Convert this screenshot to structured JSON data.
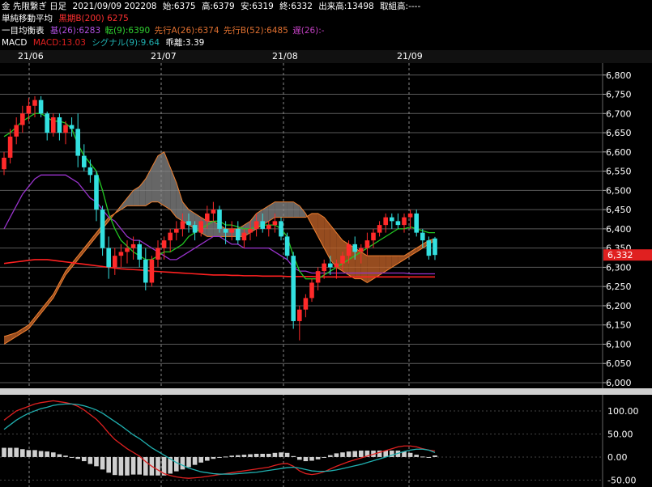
{
  "header": {
    "line1": {
      "instrument": "金 先限繋ぎ 日足",
      "date": "2021/09/09 202208",
      "open": "始:6375",
      "high": "高:6379",
      "low": "安:6319",
      "close": "終:6332",
      "volume": "出来高:13498",
      "oi": "取組高:----"
    },
    "line2": {
      "label": "単純移動平均",
      "ma200": "黒期B(200) 6275"
    },
    "line3": {
      "label": "一目均衡表",
      "kijun": "基(26):6283",
      "tenkan": "転(9):6390",
      "senkouA": "先行A(26):6374",
      "senkouB": "先行B(52):6485",
      "chikou": "遅(26):-"
    },
    "line4": {
      "label": "MACD",
      "macd": "MACD:13.03",
      "signal": "シグナル(9):9.64",
      "diff": "乖離:3.39"
    }
  },
  "time_axis": [
    "21/06",
    "21/07",
    "21/08",
    "21/09"
  ],
  "price_axis": [
    "6,800",
    "6,750",
    "6,700",
    "6,650",
    "6,600",
    "6,550",
    "6,500",
    "6,450",
    "6,400",
    "6,350",
    "6,300",
    "6,250",
    "6,200",
    "6,150",
    "6,100",
    "6,050",
    "6,000"
  ],
  "current_price_label": "6,332",
  "macd_axis": [
    "100.00",
    "50.00",
    "0.00",
    "-50.00"
  ],
  "colors": {
    "up": "#ff2a2a",
    "down": "#33e0e0",
    "tenkan": "#22c822",
    "kijun": "#9933cc",
    "cloud_bull": "#c8662a",
    "cloud_bear": "#888888",
    "ma200": "#ff2020",
    "macd": "#e02020",
    "signal": "#20b0b0",
    "hist": "#cfcfcf",
    "price_box": "#e02020"
  },
  "chart_data": {
    "type": "candlestick",
    "y_range": [
      6000,
      6810
    ],
    "macd_range": [
      -65,
      135
    ],
    "dates": [
      "06/01",
      "06/02",
      "06/03",
      "06/04",
      "06/07",
      "06/08",
      "06/09",
      "06/10",
      "06/11",
      "06/14",
      "06/15",
      "06/16",
      "06/17",
      "06/18",
      "06/21",
      "06/22",
      "06/23",
      "06/24",
      "06/25",
      "06/28",
      "06/29",
      "06/30",
      "07/01",
      "07/02",
      "07/05",
      "07/06",
      "07/07",
      "07/08",
      "07/09",
      "07/12",
      "07/13",
      "07/14",
      "07/15",
      "07/16",
      "07/19",
      "07/20",
      "07/21",
      "07/22",
      "07/26",
      "07/27",
      "07/28",
      "07/29",
      "07/30",
      "08/02",
      "08/03",
      "08/04",
      "08/05",
      "08/06",
      "08/10",
      "08/11",
      "08/12",
      "08/13",
      "08/16",
      "08/17",
      "08/18",
      "08/19",
      "08/20",
      "08/23",
      "08/24",
      "08/25",
      "08/26",
      "08/27",
      "08/30",
      "08/31",
      "09/01",
      "09/02",
      "09/03",
      "09/06",
      "09/07",
      "09/08",
      "09/09"
    ],
    "ohlc": [
      [
        6555,
        6600,
        6540,
        6585
      ],
      [
        6585,
        6660,
        6570,
        6640
      ],
      [
        6640,
        6690,
        6620,
        6670
      ],
      [
        6670,
        6720,
        6650,
        6700
      ],
      [
        6700,
        6740,
        6680,
        6720
      ],
      [
        6720,
        6745,
        6690,
        6735
      ],
      [
        6735,
        6745,
        6690,
        6700
      ],
      [
        6700,
        6705,
        6630,
        6650
      ],
      [
        6650,
        6700,
        6640,
        6690
      ],
      [
        6690,
        6700,
        6630,
        6650
      ],
      [
        6650,
        6680,
        6620,
        6670
      ],
      [
        6670,
        6690,
        6640,
        6660
      ],
      [
        6660,
        6700,
        6560,
        6590
      ],
      [
        6590,
        6620,
        6550,
        6560
      ],
      [
        6560,
        6580,
        6520,
        6540
      ],
      [
        6540,
        6550,
        6420,
        6450
      ],
      [
        6450,
        6460,
        6330,
        6350
      ],
      [
        6350,
        6380,
        6270,
        6300
      ],
      [
        6300,
        6350,
        6280,
        6330
      ],
      [
        6330,
        6360,
        6300,
        6340
      ],
      [
        6340,
        6370,
        6310,
        6350
      ],
      [
        6350,
        6380,
        6320,
        6360
      ],
      [
        6360,
        6370,
        6300,
        6320
      ],
      [
        6320,
        6350,
        6240,
        6260
      ],
      [
        6260,
        6330,
        6250,
        6320
      ],
      [
        6320,
        6370,
        6300,
        6350
      ],
      [
        6350,
        6380,
        6320,
        6370
      ],
      [
        6370,
        6400,
        6340,
        6390
      ],
      [
        6390,
        6420,
        6370,
        6400
      ],
      [
        6400,
        6440,
        6380,
        6420
      ],
      [
        6420,
        6440,
        6390,
        6410
      ],
      [
        6410,
        6420,
        6370,
        6390
      ],
      [
        6390,
        6430,
        6380,
        6420
      ],
      [
        6420,
        6460,
        6400,
        6440
      ],
      [
        6440,
        6470,
        6420,
        6450
      ],
      [
        6450,
        6460,
        6390,
        6400
      ],
      [
        6400,
        6420,
        6360,
        6390
      ],
      [
        6390,
        6420,
        6370,
        6400
      ],
      [
        6400,
        6420,
        6360,
        6370
      ],
      [
        6370,
        6400,
        6350,
        6390
      ],
      [
        6390,
        6420,
        6370,
        6400
      ],
      [
        6400,
        6440,
        6380,
        6420
      ],
      [
        6420,
        6440,
        6390,
        6400
      ],
      [
        6400,
        6420,
        6380,
        6410
      ],
      [
        6410,
        6440,
        6390,
        6420
      ],
      [
        6420,
        6430,
        6370,
        6380
      ],
      [
        6380,
        6390,
        6320,
        6330
      ],
      [
        6330,
        6340,
        6140,
        6160
      ],
      [
        6160,
        6200,
        6110,
        6190
      ],
      [
        6190,
        6230,
        6170,
        6220
      ],
      [
        6220,
        6270,
        6210,
        6260
      ],
      [
        6260,
        6300,
        6240,
        6290
      ],
      [
        6290,
        6320,
        6270,
        6310
      ],
      [
        6310,
        6330,
        6280,
        6300
      ],
      [
        6300,
        6320,
        6270,
        6310
      ],
      [
        6310,
        6340,
        6290,
        6330
      ],
      [
        6330,
        6370,
        6310,
        6360
      ],
      [
        6360,
        6380,
        6320,
        6340
      ],
      [
        6340,
        6360,
        6310,
        6350
      ],
      [
        6350,
        6390,
        6330,
        6370
      ],
      [
        6370,
        6400,
        6350,
        6390
      ],
      [
        6390,
        6420,
        6380,
        6410
      ],
      [
        6410,
        6440,
        6390,
        6430
      ],
      [
        6430,
        6440,
        6400,
        6420
      ],
      [
        6420,
        6440,
        6400,
        6410
      ],
      [
        6410,
        6440,
        6390,
        6430
      ],
      [
        6430,
        6450,
        6400,
        6440
      ],
      [
        6440,
        6450,
        6380,
        6390
      ],
      [
        6390,
        6400,
        6350,
        6370
      ],
      [
        6370,
        6380,
        6320,
        6330
      ],
      [
        6375,
        6379,
        6319,
        6332
      ]
    ],
    "tenkan": [
      6640,
      6650,
      6665,
      6680,
      6690,
      6700,
      6700,
      6690,
      6680,
      6680,
      6675,
      6660,
      6620,
      6590,
      6570,
      6550,
      6500,
      6440,
      6400,
      6370,
      6355,
      6340,
      6330,
      6320,
      6320,
      6330,
      6340,
      6340,
      6350,
      6360,
      6380,
      6390,
      6400,
      6410,
      6420,
      6420,
      6410,
      6410,
      6405,
      6400,
      6400,
      6405,
      6410,
      6410,
      6410,
      6400,
      6380,
      6330,
      6290,
      6270,
      6270,
      6270,
      6280,
      6290,
      6300,
      6310,
      6320,
      6330,
      6340,
      6350,
      6360,
      6370,
      6380,
      6390,
      6400,
      6400,
      6405,
      6400,
      6395,
      6390,
      6390
    ],
    "kijun": [
      6400,
      6430,
      6460,
      6490,
      6510,
      6530,
      6540,
      6540,
      6540,
      6540,
      6540,
      6530,
      6520,
      6500,
      6480,
      6470,
      6450,
      6430,
      6420,
      6400,
      6380,
      6370,
      6370,
      6360,
      6350,
      6340,
      6330,
      6320,
      6320,
      6330,
      6340,
      6350,
      6360,
      6370,
      6380,
      6380,
      6370,
      6360,
      6360,
      6350,
      6350,
      6350,
      6350,
      6350,
      6340,
      6330,
      6320,
      6300,
      6290,
      6290,
      6285,
      6285,
      6285,
      6285,
      6285,
      6285,
      6285,
      6285,
      6285,
      6285,
      6285,
      6285,
      6285,
      6285,
      6285,
      6285,
      6283,
      6283,
      6283,
      6283,
      6283
    ],
    "senkou_a": [
      6120,
      6125,
      6130,
      6140,
      6150,
      6170,
      6190,
      6210,
      6230,
      6260,
      6290,
      6310,
      6330,
      6350,
      6370,
      6390,
      6410,
      6430,
      6440,
      6450,
      6460,
      6460,
      6460,
      6460,
      6470,
      6470,
      6460,
      6450,
      6430,
      6420,
      6410,
      6400,
      6390,
      6380,
      6380,
      6380,
      6380,
      6380,
      6380,
      6380,
      6390,
      6400,
      6410,
      6420,
      6430,
      6430,
      6430,
      6430,
      6430,
      6430,
      6440,
      6440,
      6430,
      6410,
      6390,
      6370,
      6360,
      6350,
      6340,
      6330,
      6330,
      6330,
      6330,
      6330,
      6330,
      6330,
      6340,
      6350,
      6360,
      6370,
      6374
    ],
    "senkou_b": [
      6100,
      6110,
      6120,
      6130,
      6140,
      6160,
      6180,
      6200,
      6220,
      6250,
      6280,
      6300,
      6320,
      6340,
      6360,
      6380,
      6400,
      6420,
      6440,
      6460,
      6480,
      6500,
      6510,
      6530,
      6560,
      6590,
      6600,
      6560,
      6520,
      6470,
      6450,
      6440,
      6430,
      6420,
      6420,
      6410,
      6400,
      6400,
      6400,
      6410,
      6420,
      6440,
      6450,
      6460,
      6470,
      6470,
      6470,
      6470,
      6460,
      6440,
      6410,
      6380,
      6350,
      6320,
      6300,
      6290,
      6280,
      6270,
      6270,
      6260,
      6270,
      6280,
      6290,
      6300,
      6310,
      6320,
      6330,
      6340,
      6350,
      6360,
      6370
    ],
    "ma200": [
      6310,
      6312,
      6314,
      6316,
      6318,
      6320,
      6320,
      6320,
      6318,
      6316,
      6314,
      6312,
      6310,
      6308,
      6306,
      6304,
      6302,
      6300,
      6298,
      6296,
      6295,
      6294,
      6293,
      6292,
      6290,
      6289,
      6288,
      6287,
      6286,
      6285,
      6284,
      6283,
      6282,
      6281,
      6280,
      6280,
      6280,
      6279,
      6279,
      6278,
      6278,
      6278,
      6277,
      6277,
      6277,
      6277,
      6276,
      6276,
      6276,
      6276,
      6276,
      6275,
      6275,
      6275,
      6275,
      6275,
      6275,
      6275,
      6275,
      6275,
      6275,
      6275,
      6275,
      6275,
      6275,
      6275,
      6275,
      6275,
      6275,
      6275,
      6275
    ],
    "macd": [
      80,
      90,
      100,
      105,
      110,
      115,
      118,
      120,
      122,
      120,
      118,
      115,
      110,
      102,
      92,
      82,
      68,
      52,
      38,
      28,
      18,
      10,
      2,
      -10,
      -20,
      -28,
      -36,
      -40,
      -43,
      -45,
      -46,
      -45,
      -44,
      -42,
      -40,
      -38,
      -36,
      -34,
      -32,
      -30,
      -28,
      -26,
      -24,
      -22,
      -18,
      -15,
      -14,
      -20,
      -30,
      -36,
      -38,
      -36,
      -32,
      -26,
      -20,
      -15,
      -10,
      -6,
      -2,
      2,
      6,
      10,
      14,
      18,
      22,
      24,
      24,
      22,
      18,
      15,
      13
    ],
    "signal": [
      60,
      70,
      80,
      88,
      95,
      100,
      105,
      108,
      112,
      114,
      115,
      115,
      114,
      111,
      107,
      102,
      95,
      86,
      77,
      68,
      58,
      48,
      40,
      30,
      20,
      12,
      4,
      -4,
      -12,
      -18,
      -24,
      -28,
      -32,
      -34,
      -36,
      -37,
      -37,
      -37,
      -36,
      -35,
      -34,
      -33,
      -31,
      -29,
      -27,
      -25,
      -23,
      -22,
      -24,
      -27,
      -30,
      -31,
      -31,
      -30,
      -28,
      -25,
      -22,
      -19,
      -16,
      -12,
      -8,
      -4,
      0,
      4,
      8,
      12,
      15,
      17,
      17,
      15,
      9.64
    ],
    "hist": [
      20,
      20,
      20,
      17,
      15,
      15,
      13,
      12,
      10,
      6,
      3,
      0,
      -4,
      -9,
      -15,
      -20,
      -27,
      -34,
      -39,
      -40,
      -40,
      -38,
      -38,
      -40,
      -40,
      -40,
      -40,
      -36,
      -31,
      -27,
      -22,
      -17,
      -12,
      -8,
      -4,
      -1,
      1,
      3,
      4,
      5,
      6,
      7,
      7,
      7,
      9,
      10,
      9,
      2,
      -6,
      -9,
      -8,
      -5,
      -1,
      4,
      8,
      10,
      12,
      13,
      14,
      14,
      14,
      14,
      14,
      14,
      14,
      12,
      9,
      5,
      1,
      0,
      3.39
    ]
  }
}
